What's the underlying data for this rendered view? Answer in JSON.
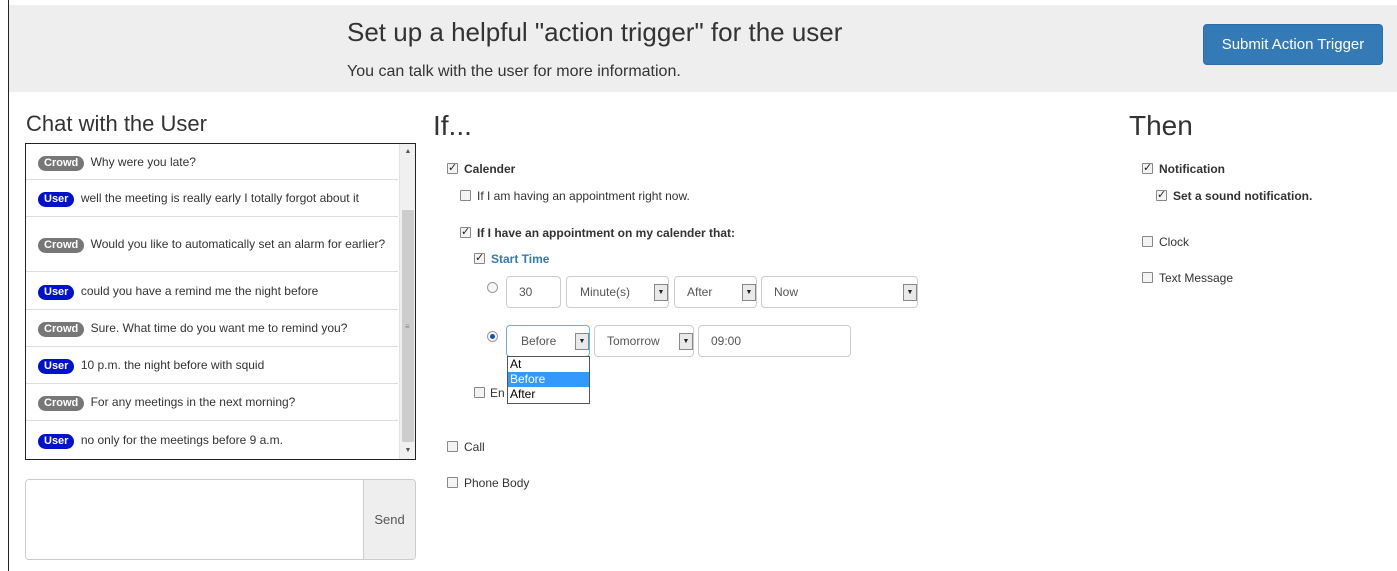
{
  "header": {
    "title": "Set up a helpful \"action trigger\" for the user",
    "subtitle": "You can talk with the user for more information.",
    "submit_label": "Submit Action Trigger"
  },
  "chat": {
    "heading": "Chat with the User",
    "messages": [
      {
        "role": "Crowd",
        "text": "Why were you late?"
      },
      {
        "role": "User",
        "text": "well the meeting is really early I totally forgot about it"
      },
      {
        "role": "Crowd",
        "text": "Would you like to automatically set an alarm for earlier?"
      },
      {
        "role": "User",
        "text": "could you have a remind me the night before"
      },
      {
        "role": "Crowd",
        "text": "Sure. What time do you want me to remind you?"
      },
      {
        "role": "User",
        "text": "10 p.m. the night before with squid"
      },
      {
        "role": "Crowd",
        "text": "For any meetings in the next morning?"
      },
      {
        "role": "User",
        "text": "no only for the meetings before 9 a.m."
      }
    ],
    "input_value": "",
    "send_label": "Send"
  },
  "if_section": {
    "heading": "If...",
    "calendar": {
      "label": "Calender",
      "checked": true
    },
    "appointment_now": {
      "label": "If I am having an appointment right now.",
      "checked": false
    },
    "appointment_that": {
      "label": "If I have an appointment on my calender that:",
      "checked": true
    },
    "start_time": {
      "label": "Start Time",
      "checked": true
    },
    "option1": {
      "selected": false,
      "amount": "30",
      "unit": "Minute(s)",
      "relation": "After",
      "reference": "Now"
    },
    "option2": {
      "selected": true,
      "relation": "Before",
      "day": "Tomorrow",
      "time": "09:00",
      "dropdown_options": [
        "At",
        "Before",
        "After"
      ],
      "dropdown_selected": "Before"
    },
    "end_time": {
      "label": "En",
      "checked": false
    },
    "call": {
      "label": "Call",
      "checked": false
    },
    "phone_body": {
      "label": "Phone Body",
      "checked": false
    }
  },
  "then_section": {
    "heading": "Then",
    "notification": {
      "label": "Notification",
      "checked": true
    },
    "sound_notification": {
      "label": "Set a sound notification.",
      "checked": true
    },
    "clock": {
      "label": "Clock",
      "checked": false
    },
    "text_message": {
      "label": "Text Message",
      "checked": false
    }
  },
  "colors": {
    "header_bg": "#eeeeee",
    "primary": "#337ab7",
    "crowd_badge": "#777777",
    "user_badge": "#0011cc",
    "dropdown_highlight": "#3399ff"
  }
}
